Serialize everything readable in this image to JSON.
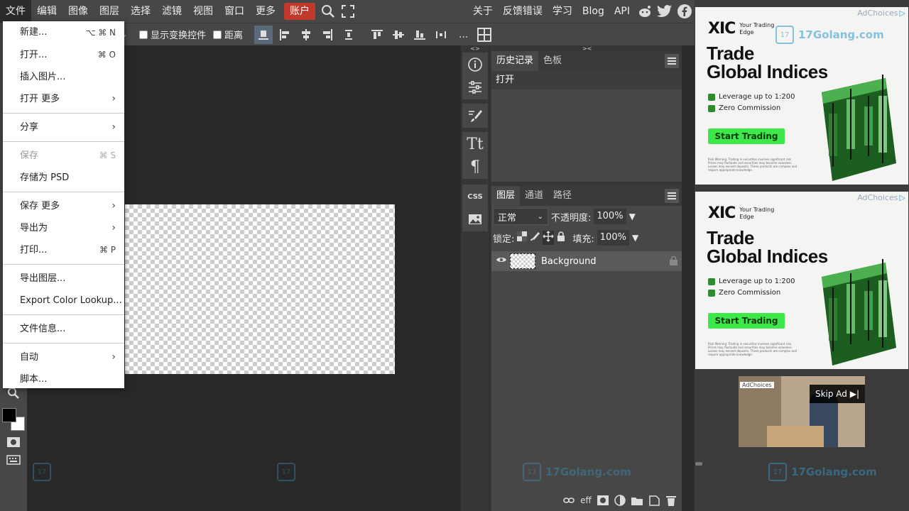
{
  "menubar": {
    "items": [
      "文件",
      "编辑",
      "图像",
      "图层",
      "选择",
      "滤镜",
      "视图",
      "窗口",
      "更多"
    ],
    "account": "账户",
    "right_links": [
      "关于",
      "反馈错误",
      "学习",
      "Blog",
      "API"
    ]
  },
  "options": {
    "show_transform": "显示变换控件",
    "distance": "距离",
    "more": "..."
  },
  "file_menu": {
    "items": [
      {
        "label": "新建...",
        "shortcut": "⌥ ⌘ N"
      },
      {
        "label": "打开...",
        "shortcut": "⌘ O"
      },
      {
        "label": "插入图片..."
      },
      {
        "label": "打开 更多",
        "submenu": "›"
      },
      {
        "label": "分享",
        "submenu": "›"
      },
      {
        "label": "保存",
        "shortcut": "⌘ S",
        "disabled": true
      },
      {
        "label": "存储为 PSD"
      },
      {
        "label": "保存 更多",
        "submenu": "›"
      },
      {
        "label": "导出为",
        "submenu": "›"
      },
      {
        "label": "打印...",
        "shortcut": "⌘ P"
      },
      {
        "label": "导出图层..."
      },
      {
        "label": "Export Color Lookup..."
      },
      {
        "label": "文件信息..."
      },
      {
        "label": "自动",
        "submenu": "›"
      },
      {
        "label": "脚本..."
      }
    ]
  },
  "side": {
    "top_arrows_left": "<>",
    "top_arrows_right": "><",
    "css": "CSS"
  },
  "history_panel": {
    "tabs": [
      "历史记录",
      "色板"
    ],
    "items": [
      "打开"
    ]
  },
  "layers_panel": {
    "tabs": [
      "图层",
      "通道",
      "路径"
    ],
    "blend_mode": "正常",
    "opacity_label": "不透明度:",
    "opacity_value": "100%",
    "lock_label": "锁定:",
    "fill_label": "填充:",
    "fill_value": "100%",
    "layers": [
      {
        "name": "Background"
      }
    ],
    "footer_eff": "eff"
  },
  "ads": {
    "adchoices": "AdChoices",
    "brand": "XIC",
    "tagline": "Your Trading Edge",
    "headline_1": "Trade",
    "headline_2": "Global Indices",
    "bullet_1": "Leverage up to 1:200",
    "bullet_2": "Zero Commission",
    "cta": "Start Trading",
    "fine_print": "Risk Warning: Trading in securities involves significant risk. Prices may fluctuate and securities may become valueless. Losses may exceed deposits. These products are complex and require appropriate knowledge.",
    "skip": "Skip Ad ▶|"
  },
  "watermark": {
    "name": "17Golang.com"
  },
  "colors": {
    "accent": "#c0392b",
    "panel": "#474747",
    "canvas": "#282828",
    "ad_green": "#3ee84a"
  }
}
